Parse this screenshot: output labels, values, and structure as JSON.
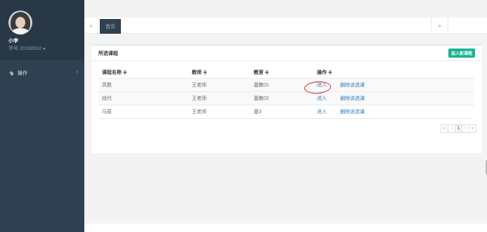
{
  "user": {
    "name": "小李",
    "id_text": "学号 20180002"
  },
  "sidebar": {
    "items": [
      {
        "label": "操作",
        "icon": "home-icon",
        "arrow": "‹"
      }
    ]
  },
  "tabs": {
    "prev": "«",
    "next": "»",
    "items": [
      {
        "label": "首页",
        "active": true
      }
    ]
  },
  "panel": {
    "title": "所选课程",
    "add_button": "加入新课程"
  },
  "table": {
    "headers": [
      "课程名称 ≑",
      "教师 ≑",
      "教室 ≑",
      "操作 ≑"
    ],
    "rows": [
      {
        "course": "高数",
        "teacher": "王老师",
        "room": "基教01",
        "enter": "进入",
        "delete": "删除该选课"
      },
      {
        "course": "线代",
        "teacher": "王老师",
        "room": "基教02",
        "enter": "进入",
        "delete": "删除该选课"
      },
      {
        "course": "马原",
        "teacher": "王老师",
        "room": "基3",
        "enter": "进入",
        "delete": "删除该选课"
      }
    ]
  },
  "pagination": {
    "first": "«",
    "prev": "‹",
    "current": "1",
    "next": "›",
    "last": "»"
  },
  "colors": {
    "sidebar": "#2f4050",
    "accent": "#1ab394",
    "link": "#337ab7",
    "annotation": "#d9232f"
  }
}
